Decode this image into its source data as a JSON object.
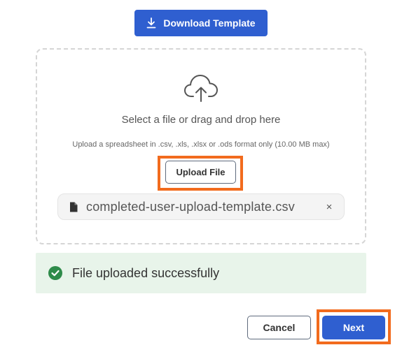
{
  "toolbar": {
    "download_label": "Download Template"
  },
  "dropzone": {
    "title": "Select a file or drag and drop here",
    "hint": "Upload a spreadsheet in .csv, .xls, .xlsx or .ods format only (10.00 MB max)",
    "upload_label": "Upload File",
    "icon": "cloud-upload-icon"
  },
  "file": {
    "name": "completed-user-upload-template.csv",
    "remove_label": "×",
    "icon": "file-icon"
  },
  "status": {
    "message": "File uploaded successfully",
    "icon": "check-circle-icon",
    "color": "#2e8b4a"
  },
  "footer": {
    "cancel_label": "Cancel",
    "next_label": "Next"
  },
  "colors": {
    "primary": "#2f5fd0",
    "highlight": "#f26b1d",
    "success_bg": "#e8f4ea"
  }
}
